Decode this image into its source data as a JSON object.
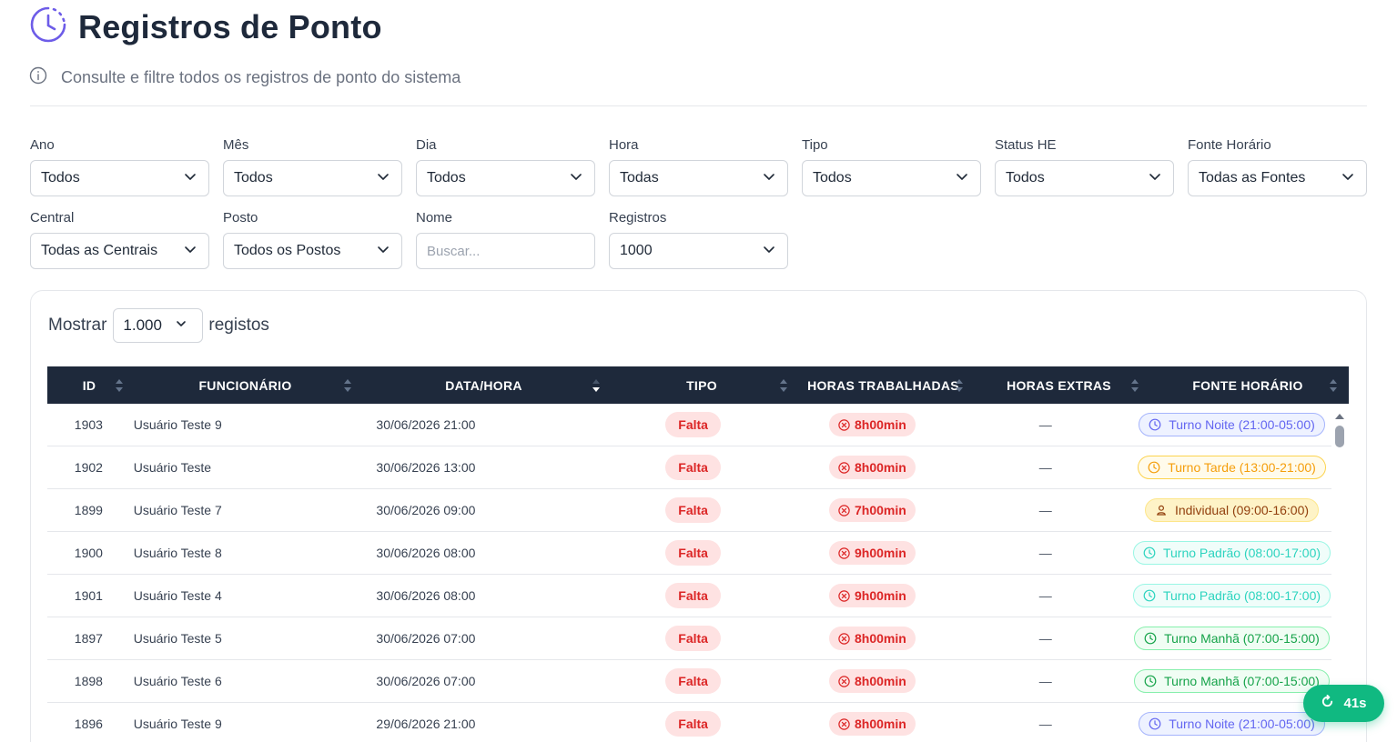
{
  "header": {
    "title": "Registros de Ponto",
    "subtitle": "Consulte e filtre todos os registros de ponto do sistema",
    "accent": "#6d5ce8"
  },
  "filters": [
    {
      "key": "ano",
      "label": "Ano",
      "value": "Todos"
    },
    {
      "key": "mes",
      "label": "Mês",
      "value": "Todos"
    },
    {
      "key": "dia",
      "label": "Dia",
      "value": "Todos"
    },
    {
      "key": "hora",
      "label": "Hora",
      "value": "Todas"
    },
    {
      "key": "tipo",
      "label": "Tipo",
      "value": "Todos"
    },
    {
      "key": "status-he",
      "label": "Status HE",
      "value": "Todos"
    },
    {
      "key": "fonte-horario",
      "label": "Fonte Horário",
      "value": "Todas as Fontes"
    },
    {
      "key": "central",
      "label": "Central",
      "value": "Todas as Centrais"
    },
    {
      "key": "posto",
      "label": "Posto",
      "value": "Todos os Postos"
    },
    {
      "key": "nome",
      "label": "Nome",
      "placeholder": "Buscar..."
    },
    {
      "key": "registros",
      "label": "Registros",
      "value": "1000"
    }
  ],
  "table": {
    "show_label": "Mostrar",
    "show_value": "1.000",
    "show_suffix": "registos",
    "columns": [
      "ID",
      "FUNCIONÁRIO",
      "DATA/HORA",
      "TIPO",
      "HORAS TRABALHADAS",
      "HORAS EXTRAS",
      "FONTE HORÁRIO"
    ],
    "rows": [
      {
        "id": "1903",
        "funcionario": "Usuário Teste 9",
        "data_hora": "30/06/2026 21:00",
        "tipo": "Falta",
        "horas": "8h00min",
        "extras": "—",
        "fonte": "Turno Noite (21:00-05:00)",
        "fonte_kind": "noite"
      },
      {
        "id": "1902",
        "funcionario": "Usuário Teste",
        "data_hora": "30/06/2026 13:00",
        "tipo": "Falta",
        "horas": "8h00min",
        "extras": "—",
        "fonte": "Turno Tarde (13:00-21:00)",
        "fonte_kind": "tarde"
      },
      {
        "id": "1899",
        "funcionario": "Usuário Teste 7",
        "data_hora": "30/06/2026 09:00",
        "tipo": "Falta",
        "horas": "7h00min",
        "extras": "—",
        "fonte": "Individual (09:00-16:00)",
        "fonte_kind": "individual"
      },
      {
        "id": "1900",
        "funcionario": "Usuário Teste 8",
        "data_hora": "30/06/2026 08:00",
        "tipo": "Falta",
        "horas": "9h00min",
        "extras": "—",
        "fonte": "Turno Padrão (08:00-17:00)",
        "fonte_kind": "padrao"
      },
      {
        "id": "1901",
        "funcionario": "Usuário Teste 4",
        "data_hora": "30/06/2026 08:00",
        "tipo": "Falta",
        "horas": "9h00min",
        "extras": "—",
        "fonte": "Turno Padrão (08:00-17:00)",
        "fonte_kind": "padrao"
      },
      {
        "id": "1897",
        "funcionario": "Usuário Teste 5",
        "data_hora": "30/06/2026 07:00",
        "tipo": "Falta",
        "horas": "8h00min",
        "extras": "—",
        "fonte": "Turno Manhã (07:00-15:00)",
        "fonte_kind": "manha"
      },
      {
        "id": "1898",
        "funcionario": "Usuário Teste 6",
        "data_hora": "30/06/2026 07:00",
        "tipo": "Falta",
        "horas": "8h00min",
        "extras": "—",
        "fonte": "Turno Manhã (07:00-15:00)",
        "fonte_kind": "manha"
      },
      {
        "id": "1896",
        "funcionario": "Usuário Teste 9",
        "data_hora": "29/06/2026 21:00",
        "tipo": "Falta",
        "horas": "8h00min",
        "extras": "—",
        "fonte": "Turno Noite (21:00-05:00)",
        "fonte_kind": "noite"
      }
    ]
  },
  "fonte_styles": {
    "noite": {
      "text": "#6366f1",
      "bg": "#eef2ff",
      "border": "#a5b4fc",
      "icon": "clock-icon"
    },
    "tarde": {
      "text": "#f59e0b",
      "bg": "#fffbeb",
      "border": "#fcd34d",
      "icon": "clock-icon"
    },
    "individual": {
      "text": "#92400e",
      "bg": "#fef3c7",
      "border": "#fde68a",
      "icon": "user-icon"
    },
    "padrao": {
      "text": "#2dd4bf",
      "bg": "#f0fdfa",
      "border": "#99f6e4",
      "icon": "clock-icon"
    },
    "manha": {
      "text": "#16a34a",
      "bg": "#f0fdf4",
      "border": "#86efac",
      "icon": "clock-icon"
    }
  },
  "refresh": {
    "label": "41s",
    "icon": "refresh-icon",
    "color": "#10b981"
  }
}
